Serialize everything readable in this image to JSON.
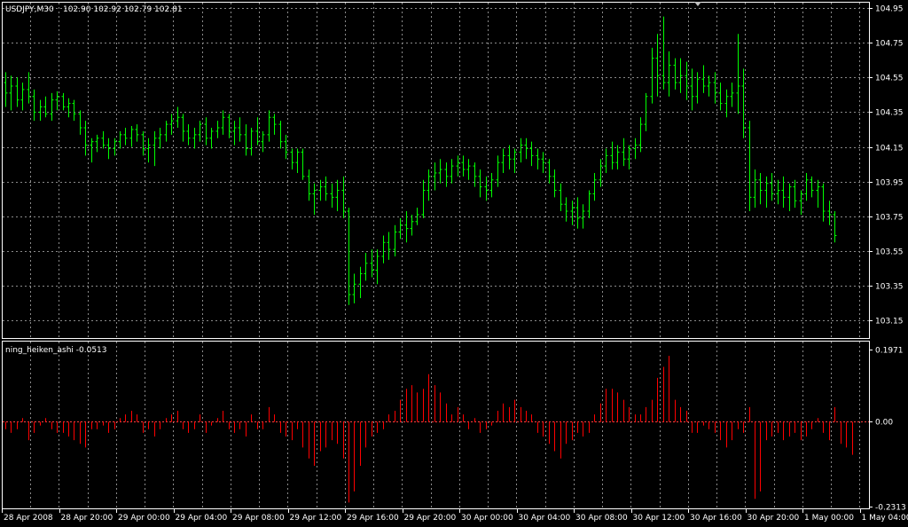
{
  "header": {
    "symbol_label": "USDJPY,M30",
    "ohlc_label": "102.90  102.92  102.79  102.81"
  },
  "indicator": {
    "title": "ning_heiken_ashi -0.0513"
  },
  "colors": {
    "background": "#000000",
    "grid": "#8a8a8a",
    "frame": "#ffffff",
    "price_bars": "#00ff00",
    "histogram": "#ff0000",
    "zero_line": "#ff4040"
  },
  "chart_data": [
    {
      "type": "ohlc",
      "title": "USDJPY,M30",
      "ylim": [
        103.05,
        104.98
      ],
      "y_ticks": [
        "104.95",
        "104.75",
        "104.55",
        "104.35",
        "104.15",
        "103.95",
        "103.75",
        "103.55",
        "103.35",
        "103.15"
      ],
      "y_tick_values": [
        104.95,
        104.75,
        104.55,
        104.35,
        104.15,
        103.95,
        103.75,
        103.55,
        103.35,
        103.15
      ],
      "grid": true,
      "bar_spacing_index_units": 1,
      "bars": [
        [
          104.52,
          104.58,
          104.38,
          104.46
        ],
        [
          104.46,
          104.56,
          104.36,
          104.5
        ],
        [
          104.5,
          104.55,
          104.38,
          104.42
        ],
        [
          104.42,
          104.52,
          104.36,
          104.48
        ],
        [
          104.48,
          104.58,
          104.4,
          104.44
        ],
        [
          104.44,
          104.48,
          104.3,
          104.35
        ],
        [
          104.35,
          104.42,
          104.3,
          104.38
        ],
        [
          104.38,
          104.44,
          104.32,
          104.34
        ],
        [
          104.34,
          104.46,
          104.3,
          104.42
        ],
        [
          104.42,
          104.47,
          104.36,
          104.44
        ],
        [
          104.44,
          104.46,
          104.36,
          104.38
        ],
        [
          104.38,
          104.43,
          104.32,
          104.4
        ],
        [
          104.4,
          104.42,
          104.3,
          104.34
        ],
        [
          104.34,
          104.36,
          104.22,
          104.26
        ],
        [
          104.26,
          104.3,
          104.1,
          104.16
        ],
        [
          104.16,
          104.2,
          104.06,
          104.18
        ],
        [
          104.18,
          104.22,
          104.12,
          104.2
        ],
        [
          104.2,
          104.24,
          104.14,
          104.16
        ],
        [
          104.16,
          104.2,
          104.08,
          104.14
        ],
        [
          104.14,
          104.2,
          104.1,
          104.18
        ],
        [
          104.18,
          104.24,
          104.14,
          104.22
        ],
        [
          104.22,
          104.26,
          104.16,
          104.2
        ],
        [
          104.2,
          104.27,
          104.15,
          104.25
        ],
        [
          104.25,
          104.28,
          104.18,
          104.22
        ],
        [
          104.22,
          104.24,
          104.1,
          104.14
        ],
        [
          104.14,
          104.2,
          104.06,
          104.16
        ],
        [
          104.16,
          104.24,
          104.04,
          104.2
        ],
        [
          104.2,
          104.26,
          104.14,
          104.22
        ],
        [
          104.22,
          104.3,
          104.18,
          104.28
        ],
        [
          104.28,
          104.34,
          104.22,
          104.3
        ],
        [
          104.3,
          104.38,
          104.26,
          104.32
        ],
        [
          104.32,
          104.34,
          104.18,
          104.24
        ],
        [
          104.24,
          104.28,
          104.16,
          104.2
        ],
        [
          104.2,
          104.26,
          104.14,
          104.22
        ],
        [
          104.22,
          104.3,
          104.18,
          104.28
        ],
        [
          104.28,
          104.32,
          104.16,
          104.2
        ],
        [
          104.2,
          104.26,
          104.14,
          104.24
        ],
        [
          104.24,
          104.3,
          104.2,
          104.26
        ],
        [
          104.26,
          104.36,
          104.22,
          104.32
        ],
        [
          104.32,
          104.34,
          104.2,
          104.24
        ],
        [
          104.24,
          104.3,
          104.16,
          104.26
        ],
        [
          104.26,
          104.32,
          104.18,
          104.22
        ],
        [
          104.22,
          104.28,
          104.1,
          104.14
        ],
        [
          104.14,
          104.26,
          104.1,
          104.24
        ],
        [
          104.24,
          104.32,
          104.16,
          104.18
        ],
        [
          104.18,
          104.24,
          104.12,
          104.22
        ],
        [
          104.22,
          104.36,
          104.18,
          104.32
        ],
        [
          104.32,
          104.34,
          104.22,
          104.28
        ],
        [
          104.28,
          104.3,
          104.14,
          104.18
        ],
        [
          104.18,
          104.22,
          104.08,
          104.12
        ],
        [
          104.12,
          104.14,
          104.02,
          104.06
        ],
        [
          104.06,
          104.14,
          104.0,
          104.12
        ],
        [
          104.12,
          104.14,
          103.96,
          103.98
        ],
        [
          103.98,
          104.02,
          103.84,
          103.88
        ],
        [
          103.88,
          103.94,
          103.76,
          103.9
        ],
        [
          103.9,
          103.96,
          103.84,
          103.92
        ],
        [
          103.92,
          103.98,
          103.84,
          103.88
        ],
        [
          103.88,
          103.94,
          103.8,
          103.86
        ],
        [
          103.86,
          103.96,
          103.78,
          103.9
        ],
        [
          103.9,
          103.98,
          103.74,
          103.78
        ],
        [
          103.78,
          103.8,
          103.24,
          103.3
        ],
        [
          103.3,
          103.42,
          103.25,
          103.36
        ],
        [
          103.36,
          103.46,
          103.28,
          103.42
        ],
        [
          103.42,
          103.54,
          103.38,
          103.48
        ],
        [
          103.48,
          103.56,
          103.4,
          103.44
        ],
        [
          103.44,
          103.56,
          103.36,
          103.52
        ],
        [
          103.52,
          103.64,
          103.48,
          103.6
        ],
        [
          103.6,
          103.66,
          103.5,
          103.56
        ],
        [
          103.56,
          103.7,
          103.52,
          103.66
        ],
        [
          103.66,
          103.74,
          103.62,
          103.7
        ],
        [
          103.7,
          103.78,
          103.6,
          103.68
        ],
        [
          103.68,
          103.76,
          103.64,
          103.72
        ],
        [
          103.72,
          103.8,
          103.7,
          103.76
        ],
        [
          103.76,
          103.96,
          103.74,
          103.9
        ],
        [
          103.9,
          104.02,
          103.84,
          103.98
        ],
        [
          103.98,
          104.06,
          103.9,
          104.0
        ],
        [
          104.0,
          104.08,
          103.94,
          104.02
        ],
        [
          104.02,
          104.06,
          103.92,
          103.98
        ],
        [
          103.98,
          104.08,
          103.94,
          104.04
        ],
        [
          104.04,
          104.1,
          103.98,
          104.06
        ],
        [
          104.06,
          104.1,
          103.98,
          104.02
        ],
        [
          104.02,
          104.08,
          103.96,
          104.04
        ],
        [
          104.04,
          104.06,
          103.92,
          103.98
        ],
        [
          103.98,
          104.02,
          103.86,
          103.92
        ],
        [
          103.92,
          103.98,
          103.84,
          103.9
        ],
        [
          103.9,
          104.0,
          103.86,
          103.96
        ],
        [
          103.96,
          104.1,
          103.92,
          104.06
        ],
        [
          104.06,
          104.14,
          104.0,
          104.1
        ],
        [
          104.1,
          104.16,
          104.02,
          104.08
        ],
        [
          104.08,
          104.14,
          104.0,
          104.12
        ],
        [
          104.12,
          104.2,
          104.06,
          104.16
        ],
        [
          104.16,
          104.2,
          104.08,
          104.14
        ],
        [
          104.14,
          104.18,
          104.04,
          104.1
        ],
        [
          104.1,
          104.14,
          104.02,
          104.08
        ],
        [
          104.08,
          104.12,
          104.0,
          104.06
        ],
        [
          104.06,
          104.08,
          103.94,
          103.98
        ],
        [
          103.98,
          104.02,
          103.86,
          103.9
        ],
        [
          103.9,
          103.94,
          103.78,
          103.82
        ],
        [
          103.82,
          103.86,
          103.72,
          103.78
        ],
        [
          103.78,
          103.84,
          103.7,
          103.8
        ],
        [
          103.8,
          103.86,
          103.68,
          103.74
        ],
        [
          103.74,
          103.82,
          103.68,
          103.78
        ],
        [
          103.78,
          103.9,
          103.74,
          103.88
        ],
        [
          103.88,
          104.0,
          103.84,
          103.96
        ],
        [
          103.96,
          104.08,
          103.92,
          104.04
        ],
        [
          104.04,
          104.14,
          104.0,
          104.1
        ],
        [
          104.1,
          104.18,
          104.02,
          104.06
        ],
        [
          104.06,
          104.16,
          104.02,
          104.12
        ],
        [
          104.12,
          104.2,
          104.04,
          104.08
        ],
        [
          104.08,
          104.16,
          104.02,
          104.14
        ],
        [
          104.14,
          104.2,
          104.08,
          104.16
        ],
        [
          104.16,
          104.32,
          104.12,
          104.28
        ],
        [
          104.28,
          104.46,
          104.24,
          104.44
        ],
        [
          104.44,
          104.72,
          104.4,
          104.66
        ],
        [
          104.66,
          104.8,
          104.44,
          104.56
        ],
        [
          104.56,
          104.9,
          104.48,
          104.52
        ],
        [
          104.52,
          104.7,
          104.44,
          104.62
        ],
        [
          104.62,
          104.66,
          104.48,
          104.52
        ],
        [
          104.52,
          104.66,
          104.46,
          104.56
        ],
        [
          104.56,
          104.64,
          104.42,
          104.5
        ],
        [
          104.5,
          104.6,
          104.36,
          104.44
        ],
        [
          104.44,
          104.58,
          104.4,
          104.54
        ],
        [
          104.54,
          104.62,
          104.46,
          104.5
        ],
        [
          104.5,
          104.56,
          104.44,
          104.52
        ],
        [
          104.52,
          104.58,
          104.4,
          104.46
        ],
        [
          104.46,
          104.52,
          104.36,
          104.4
        ],
        [
          104.4,
          104.48,
          104.32,
          104.44
        ],
        [
          104.44,
          104.52,
          104.38,
          104.46
        ],
        [
          104.46,
          104.8,
          104.34,
          104.5
        ],
        [
          104.5,
          104.6,
          104.2,
          104.26
        ],
        [
          104.26,
          104.3,
          103.78,
          103.86
        ],
        [
          103.86,
          104.02,
          103.8,
          103.96
        ],
        [
          103.96,
          104.0,
          103.82,
          103.9
        ],
        [
          103.9,
          103.98,
          103.8,
          103.94
        ],
        [
          103.94,
          104.0,
          103.84,
          103.88
        ],
        [
          103.88,
          103.96,
          103.82,
          103.9
        ],
        [
          103.9,
          103.98,
          103.8,
          103.86
        ],
        [
          103.86,
          103.94,
          103.78,
          103.92
        ],
        [
          103.92,
          103.96,
          103.8,
          103.84
        ],
        [
          103.84,
          103.9,
          103.76,
          103.88
        ],
        [
          103.88,
          104.0,
          103.84,
          103.96
        ],
        [
          103.96,
          103.98,
          103.86,
          103.9
        ],
        [
          103.9,
          103.96,
          103.8,
          103.92
        ],
        [
          103.92,
          103.94,
          103.72,
          103.78
        ],
        [
          103.78,
          103.84,
          103.7,
          103.76
        ],
        [
          103.76,
          103.78,
          103.6,
          103.64
        ]
      ]
    },
    {
      "type": "bar",
      "title": "ning_heiken_ashi -0.0513",
      "ylim": [
        -0.2313,
        0.1971
      ],
      "y_ticks": [
        "0.1971",
        "0.00",
        "-0.2313"
      ],
      "zero_line": true,
      "values": [
        -0.02,
        -0.03,
        -0.02,
        0.01,
        -0.05,
        -0.03,
        -0.01,
        0.01,
        -0.02,
        -0.03,
        -0.03,
        -0.04,
        -0.05,
        -0.06,
        -0.07,
        -0.02,
        -0.02,
        -0.01,
        -0.03,
        -0.02,
        0.01,
        0.02,
        0.03,
        0.02,
        -0.03,
        -0.02,
        -0.04,
        -0.02,
        0.01,
        0.02,
        0.03,
        -0.02,
        -0.03,
        -0.02,
        0.02,
        -0.03,
        -0.01,
        0.01,
        0.03,
        -0.02,
        -0.03,
        -0.02,
        -0.04,
        0.02,
        -0.02,
        -0.02,
        0.04,
        0.02,
        -0.03,
        -0.04,
        -0.05,
        -0.02,
        -0.07,
        -0.1,
        -0.12,
        -0.08,
        -0.07,
        -0.05,
        -0.06,
        -0.1,
        -0.22,
        -0.19,
        -0.12,
        -0.07,
        -0.04,
        -0.03,
        -0.02,
        0.02,
        0.03,
        0.06,
        0.09,
        0.1,
        0.08,
        0.09,
        0.13,
        0.1,
        0.08,
        0.05,
        0.02,
        0.04,
        0.02,
        -0.02,
        0.01,
        -0.03,
        -0.02,
        -0.01,
        0.03,
        0.05,
        0.04,
        0.06,
        0.04,
        0.03,
        0.02,
        -0.03,
        -0.04,
        -0.06,
        -0.08,
        -0.1,
        -0.06,
        -0.05,
        -0.03,
        -0.04,
        -0.03,
        0.02,
        0.05,
        0.09,
        0.09,
        0.08,
        0.06,
        0.04,
        0.02,
        0.02,
        0.04,
        0.06,
        0.12,
        0.15,
        0.18,
        0.06,
        0.04,
        0.03,
        -0.03,
        -0.03,
        -0.01,
        -0.02,
        -0.03,
        -0.05,
        -0.07,
        -0.05,
        -0.02,
        -0.03,
        0.04,
        -0.21,
        -0.19,
        -0.05,
        -0.04,
        -0.03,
        -0.05,
        -0.04,
        -0.03,
        -0.05,
        -0.04,
        -0.02,
        0.01,
        -0.03,
        -0.05,
        0.04,
        -0.06,
        -0.07,
        -0.09
      ]
    }
  ],
  "x_axis": {
    "labels": [
      "28 Apr 2008",
      "28 Apr 20:00",
      "29 Apr 00:00",
      "29 Apr 04:00",
      "29 Apr 08:00",
      "29 Apr 12:00",
      "29 Apr 16:00",
      "29 Apr 20:00",
      "30 Apr 00:00",
      "30 Apr 04:00",
      "30 Apr 08:00",
      "30 Apr 12:00",
      "30 Apr 16:00",
      "30 Apr 20:00",
      "1 May 00:00",
      "1 May 04:00"
    ]
  }
}
